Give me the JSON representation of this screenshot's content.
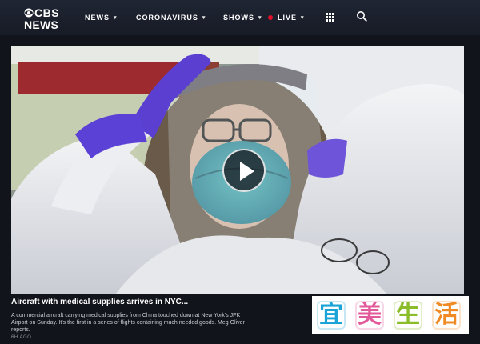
{
  "header": {
    "logo_top": "CBS",
    "logo_bottom": "NEWS",
    "nav": [
      {
        "label": "NEWS"
      },
      {
        "label": "CORONAVIRUS"
      },
      {
        "label": "SHOWS"
      },
      {
        "label": "LIVE"
      }
    ],
    "live_color": "#e0112b"
  },
  "video": {
    "play_icon": "play-icon"
  },
  "caption": {
    "title": "Aircraft with medical supplies arrives in NYC...",
    "description": "A commercial aircraft carrying medical supplies from China touched down at New York's JFK Airport on Sunday. It's the first in a series of flights containing much needed goods. Meg Oliver reports.",
    "time": "6H AGO"
  },
  "watermark": {
    "chars": [
      "宜",
      "美",
      "生",
      "活"
    ]
  }
}
